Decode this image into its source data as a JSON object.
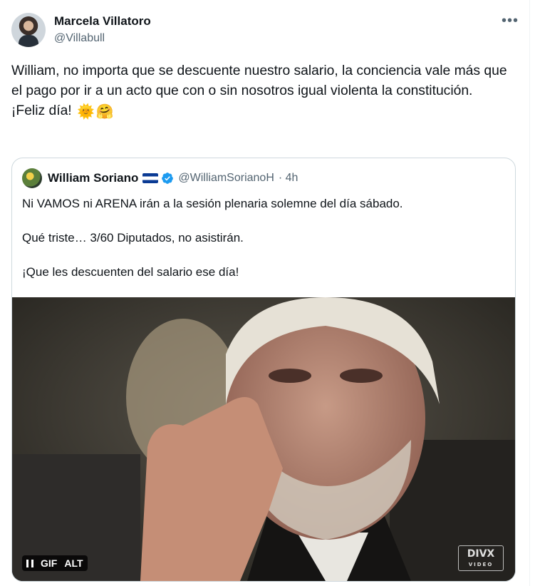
{
  "tweet": {
    "author": {
      "name": "Marcela Villatoro",
      "handle": "@Villabull"
    },
    "more_icon": "more-horizontal-icon",
    "text_lines": [
      "William, no importa que se descuente nuestro salario, la conciencia vale más que el pago por ir a un acto que con o sin nosotros igual violenta la constitución.",
      "¡Feliz día!"
    ],
    "emojis": [
      "🌞",
      "🤗"
    ]
  },
  "quote": {
    "author": {
      "name": "William Soriano",
      "handle": "@WilliamSorianoH",
      "time": "· 4h"
    },
    "flag_icon": "el-salvador-flag-icon",
    "verified_icon": "verified-badge-icon",
    "paragraphs": [
      "Ni VAMOS ni ARENA irán a la sesión plenaria solemne del día sábado.",
      "Qué triste… 3/60 Diputados, no asistirán.",
      "¡Que les descuenten del salario ese día!"
    ],
    "media": {
      "gif_label": "GIF",
      "alt_label": "ALT",
      "watermark": "DIVX",
      "watermark_sub": "VIDEO"
    }
  },
  "colors": {
    "text": "#0f1419",
    "secondary": "#536471",
    "border": "#cfd9de",
    "verified": "#1d9bf0"
  }
}
